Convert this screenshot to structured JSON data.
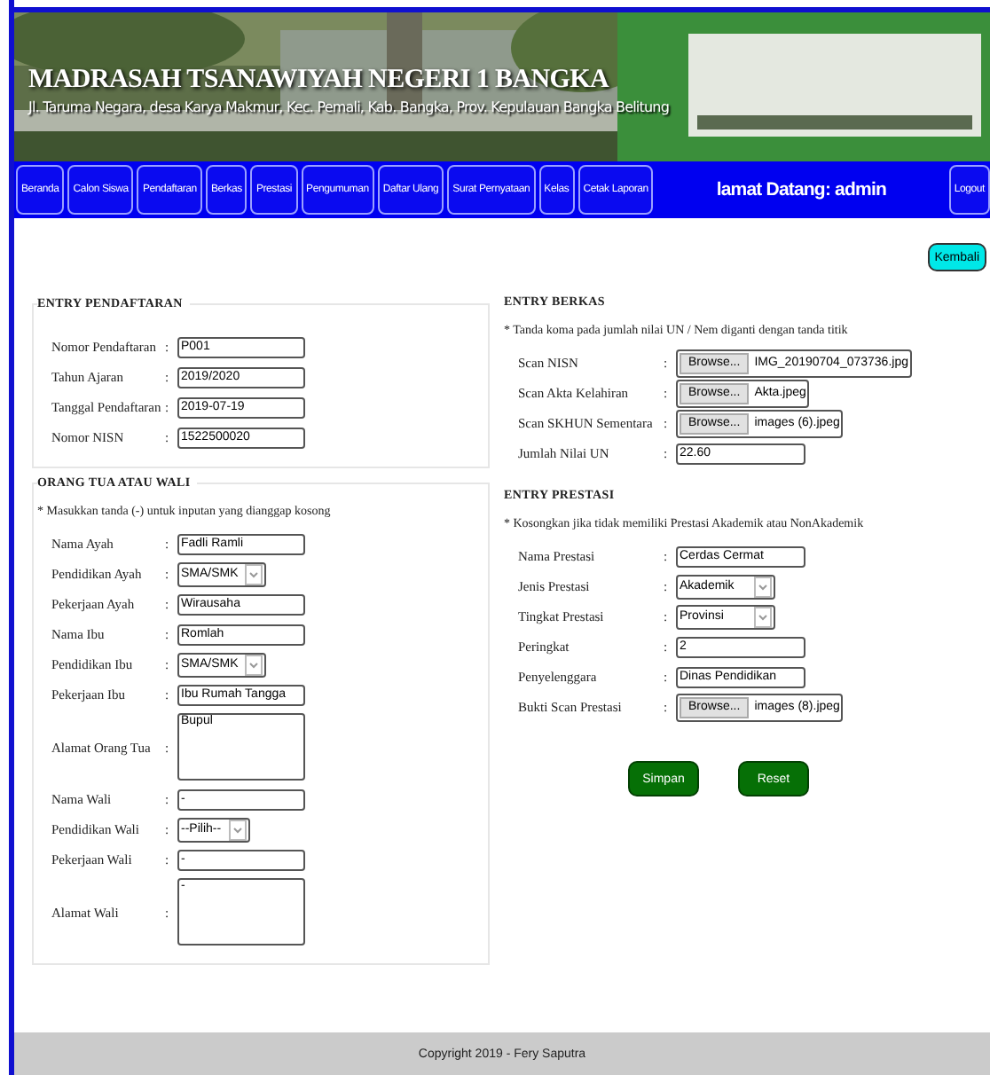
{
  "header": {
    "title": "MADRASAH TSANAWIYAH NEGERI 1 BANGKA",
    "address": "Jl. Taruma Negara, desa Karya Makmur, Kec. Pemali, Kab. Bangka, Prov. Kepulauan Bangka Belitung"
  },
  "nav": {
    "items": [
      "Beranda",
      "Calon Siswa",
      "Pendaftaran",
      "Berkas",
      "Prestasi",
      "Pengumuman",
      "Daftar Ulang",
      "Surat Pernyataan",
      "Kelas",
      "Cetak Laporan"
    ],
    "welcome": "lamat Datang: admin",
    "logout": "Logout"
  },
  "back_button": "Kembali",
  "left_column": [
    {
      "title": "ENTRY PENDAFTARAN",
      "fields": [
        {
          "kind": "text",
          "label": "Nomor Pendaftaran",
          "sep": ":",
          "value": "P001"
        },
        {
          "kind": "text",
          "label": "Tahun Ajaran",
          "sep": ":",
          "value": "2019/2020"
        },
        {
          "kind": "text",
          "label": "Tanggal Pendaftaran",
          "sep": ":",
          "value": "2019-07-19"
        },
        {
          "kind": "text",
          "label": "Nomor NISN",
          "sep": ":",
          "value": "1522500020"
        }
      ]
    },
    {
      "title": "ORANG TUA ATAU WALI",
      "note": "* Masukkan tanda (-) untuk inputan yang dianggap kosong",
      "fields": [
        {
          "kind": "text",
          "label": "Nama Ayah",
          "sep": ":",
          "value": "Fadli Ramli"
        },
        {
          "kind": "select",
          "label": "Pendidikan Ayah",
          "sep": ":",
          "value": "SMA/SMK"
        },
        {
          "kind": "text",
          "label": "Pekerjaan Ayah",
          "sep": ":",
          "value": "Wirausaha"
        },
        {
          "kind": "text",
          "label": "Nama Ibu",
          "sep": ":",
          "value": "Romlah"
        },
        {
          "kind": "select",
          "label": "Pendidikan Ibu",
          "sep": ":",
          "value": "SMA/SMK"
        },
        {
          "kind": "text",
          "label": "Pekerjaan Ibu",
          "sep": ":",
          "value": "Ibu Rumah Tangga"
        },
        {
          "kind": "textarea",
          "label": "Alamat Orang Tua",
          "sep": ":",
          "value": "Bupul"
        },
        {
          "kind": "text",
          "label": "Nama Wali",
          "sep": ":",
          "value": "-"
        },
        {
          "kind": "select",
          "label": "Pendidikan Wali",
          "sep": ":",
          "value": "--Pilih--"
        },
        {
          "kind": "text",
          "label": "Pekerjaan Wali",
          "sep": ":",
          "value": "-"
        },
        {
          "kind": "textarea",
          "label": "Alamat Wali",
          "sep": ":",
          "value": "-"
        }
      ]
    }
  ],
  "right_column": [
    {
      "title": "ENTRY BERKAS",
      "note": "* Tanda koma pada jumlah nilai UN / Nem diganti dengan tanda titik",
      "fields": [
        {
          "kind": "file",
          "label": "Scan NISN",
          "sep": ":",
          "button": "Browse...",
          "value": "IMG_20190704_073736.jpg"
        },
        {
          "kind": "file",
          "label": "Scan Akta Kelahiran",
          "sep": ":",
          "button": "Browse...",
          "value": "Akta.jpeg"
        },
        {
          "kind": "file",
          "label": "Scan SKHUN Sementara",
          "sep": ":",
          "button": "Browse...",
          "value": "images (6).jpeg"
        },
        {
          "kind": "text",
          "label": "Jumlah Nilai UN",
          "sep": ":",
          "value": "22.60"
        }
      ]
    },
    {
      "title": "ENTRY PRESTASI",
      "note": "* Kosongkan jika tidak memiliki Prestasi Akademik atau NonAkademik",
      "fields": [
        {
          "kind": "text",
          "label": "Nama Prestasi",
          "sep": ":",
          "value": "Cerdas Cermat"
        },
        {
          "kind": "select",
          "label": "Jenis Prestasi",
          "sep": ":",
          "value": "Akademik"
        },
        {
          "kind": "select",
          "label": "Tingkat Prestasi",
          "sep": ":",
          "value": "Provinsi"
        },
        {
          "kind": "text",
          "label": "Peringkat",
          "sep": ":",
          "value": "2"
        },
        {
          "kind": "text",
          "label": "Penyelenggara",
          "sep": ":",
          "value": "Dinas Pendidikan"
        },
        {
          "kind": "file",
          "label": "Bukti Scan Prestasi",
          "sep": ":",
          "button": "Browse...",
          "value": "images (8).jpeg"
        }
      ],
      "buttons": [
        "Simpan",
        "Reset"
      ]
    }
  ],
  "footer": "Copyright 2019 - Fery Saputra"
}
